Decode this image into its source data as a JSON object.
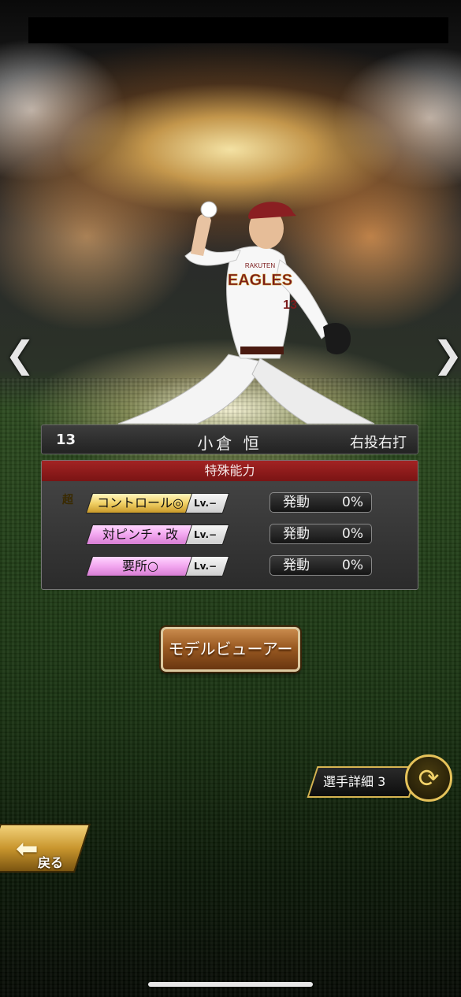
{
  "player": {
    "number": "13",
    "name": "小倉 恒",
    "handedness": "右投右打"
  },
  "abilities": {
    "header": "特殊能力",
    "items": [
      {
        "super_mark": "超",
        "label": "コントロール◎",
        "level": "Lv.−",
        "trigger_label": "発動",
        "trigger_value": "0%",
        "color": "gold"
      },
      {
        "label": "対ピンチ・改",
        "level": "Lv.−",
        "trigger_label": "発動",
        "trigger_value": "0%",
        "color": "pink"
      },
      {
        "label": "要所○",
        "level": "Lv.−",
        "trigger_label": "発動",
        "trigger_value": "0%",
        "color": "pink"
      }
    ]
  },
  "buttons": {
    "model_viewer": "モデルビューアー",
    "player_detail": "選手詳細 3",
    "back": "戻る"
  },
  "nav": {
    "prev": "❮",
    "next": "❯"
  },
  "uniform": {
    "team_small": "RAKUTEN",
    "team_big": "EAGLES",
    "number": "13"
  }
}
